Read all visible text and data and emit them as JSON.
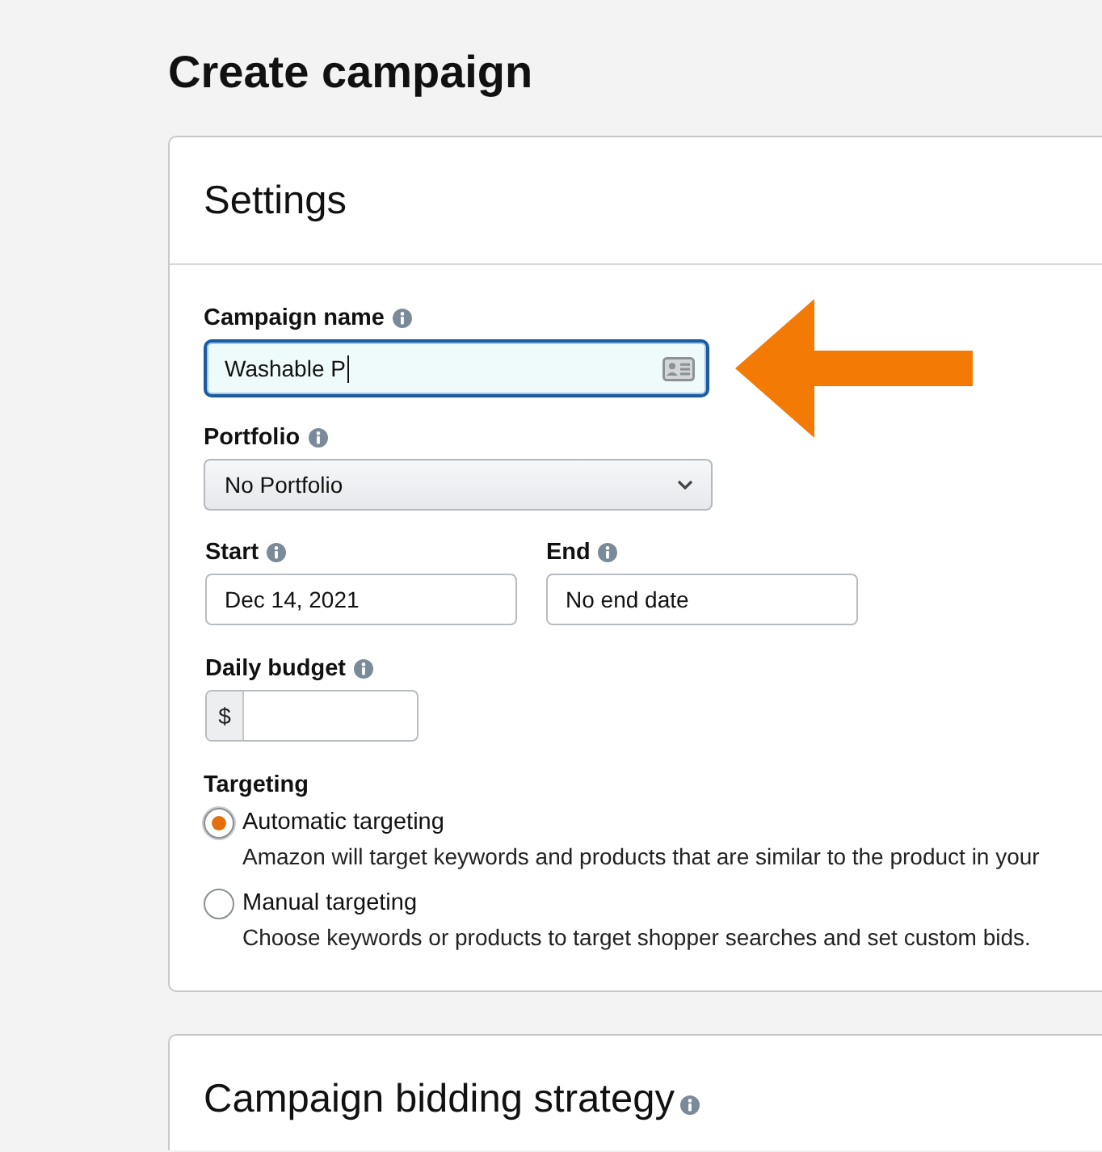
{
  "page": {
    "title": "Create campaign"
  },
  "settings": {
    "heading": "Settings",
    "campaign_name": {
      "label": "Campaign name",
      "info": true,
      "value": "Washable P",
      "focused": true
    },
    "portfolio": {
      "label": "Portfolio",
      "info": true,
      "value": "No Portfolio"
    },
    "start": {
      "label": "Start",
      "info": true,
      "value": "Dec 14, 2021"
    },
    "end": {
      "label": "End",
      "info": true,
      "value": "No end date"
    },
    "daily_budget": {
      "label": "Daily budget",
      "info": true,
      "prefix": "$"
    },
    "targeting": {
      "label": "Targeting",
      "options": [
        {
          "label": "Automatic targeting",
          "description": "Amazon will target keywords and products that are similar to the product in your",
          "selected": true
        },
        {
          "label": "Manual targeting",
          "description": "Choose keywords or products to target shopper searches and set custom bids.",
          "selected": false
        }
      ]
    }
  },
  "bidding_strategy": {
    "heading": "Campaign bidding strategy",
    "info": true
  }
}
